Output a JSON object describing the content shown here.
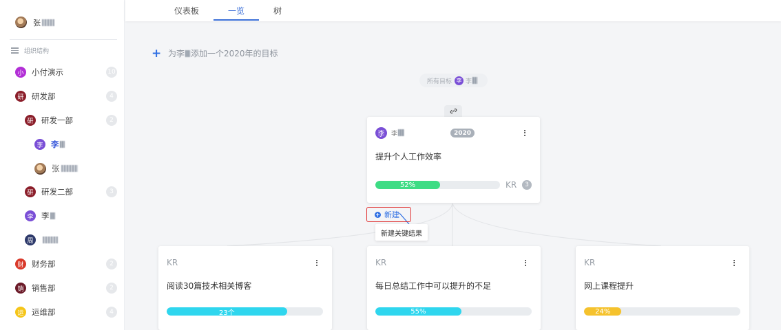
{
  "user": {
    "name_prefix": "张"
  },
  "sidebar": {
    "org_title": "组织结构",
    "items": [
      {
        "avatar_text": "小",
        "avatar_color": "#b22fd6",
        "label": "小付演示",
        "count": "10"
      },
      {
        "avatar_text": "研",
        "avatar_color": "#8b1e2a",
        "label": "研发部",
        "count": "4"
      },
      {
        "avatar_text": "研",
        "avatar_color": "#8b1e2a",
        "label": "研发一部",
        "count": "2"
      },
      {
        "avatar_text": "李",
        "avatar_color": "#7a4fd6",
        "label": "李"
      },
      {
        "avatar_text": "",
        "avatar_color": "",
        "label": "张"
      },
      {
        "avatar_text": "研",
        "avatar_color": "#8b1e2a",
        "label": "研发二部",
        "count": "3"
      },
      {
        "avatar_text": "李",
        "avatar_color": "#7a4fd6",
        "label": "李"
      },
      {
        "avatar_text": "周",
        "avatar_color": "#2e3a6b",
        "label": ""
      },
      {
        "avatar_text": "财",
        "avatar_color": "#d93a2b",
        "label": "财务部",
        "count": "2"
      },
      {
        "avatar_text": "销",
        "avatar_color": "#6b1a28",
        "label": "销售部",
        "count": "2"
      },
      {
        "avatar_text": "运",
        "avatar_color": "#f5c518",
        "label": "运维部",
        "count": "4"
      }
    ]
  },
  "tabs": [
    "仪表板",
    "一览",
    "树"
  ],
  "active_tab": "一览",
  "add_goal": {
    "prefix": "为李",
    "suffix": "添加一个2020年的目标"
  },
  "all_goals": {
    "label": "所有目标",
    "avatar_text": "李",
    "name": "李"
  },
  "goal_card": {
    "avatar_text": "李",
    "owner": "李",
    "year": "2020",
    "title": "提升个人工作效率",
    "progress_label": "52%",
    "progress": 0.52,
    "progress_color": "#3ddc84",
    "kr_label": "KR",
    "kr_count": "3"
  },
  "new_button": {
    "label": "新建",
    "tooltip": "新建关键结果"
  },
  "key_results": [
    {
      "label": "KR",
      "title": "阅读30篇技术相关博客",
      "progress_label": "23个",
      "progress": 0.77,
      "color": "#2fd6ee"
    },
    {
      "label": "KR",
      "title": "每日总结工作中可以提升的不足",
      "progress_label": "55%",
      "progress": 0.55,
      "color": "#2fd6ee"
    },
    {
      "label": "KR",
      "title": "网上课程提升",
      "progress_label": "24%",
      "progress": 0.24,
      "color": "#f5c22d"
    }
  ]
}
